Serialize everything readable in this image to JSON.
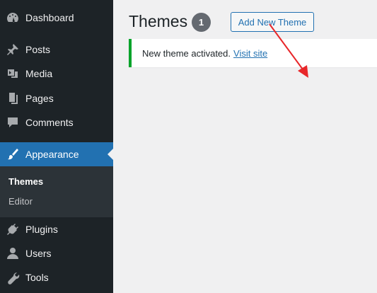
{
  "sidebar": {
    "items": [
      {
        "label": "Dashboard",
        "icon": "dashboard-icon"
      },
      {
        "label": "Posts",
        "icon": "pushpin-icon"
      },
      {
        "label": "Media",
        "icon": "media-icon"
      },
      {
        "label": "Pages",
        "icon": "pages-icon"
      },
      {
        "label": "Comments",
        "icon": "comment-icon"
      },
      {
        "label": "Appearance",
        "icon": "paintbrush-icon",
        "active": true
      },
      {
        "label": "Plugins",
        "icon": "plugin-icon"
      },
      {
        "label": "Users",
        "icon": "user-icon"
      },
      {
        "label": "Tools",
        "icon": "wrench-icon"
      }
    ],
    "submenu": [
      {
        "label": "Themes",
        "current": true
      },
      {
        "label": "Editor"
      }
    ]
  },
  "main": {
    "title": "Themes",
    "count": "1",
    "add_button": "Add New Theme",
    "notice": {
      "text": "New theme activated.",
      "link": "Visit site"
    }
  },
  "colors": {
    "sidebar_bg": "#1d2327",
    "active_bg": "#2271b1",
    "notice_border": "#00a32a",
    "annotation_arrow": "#e8272a"
  }
}
